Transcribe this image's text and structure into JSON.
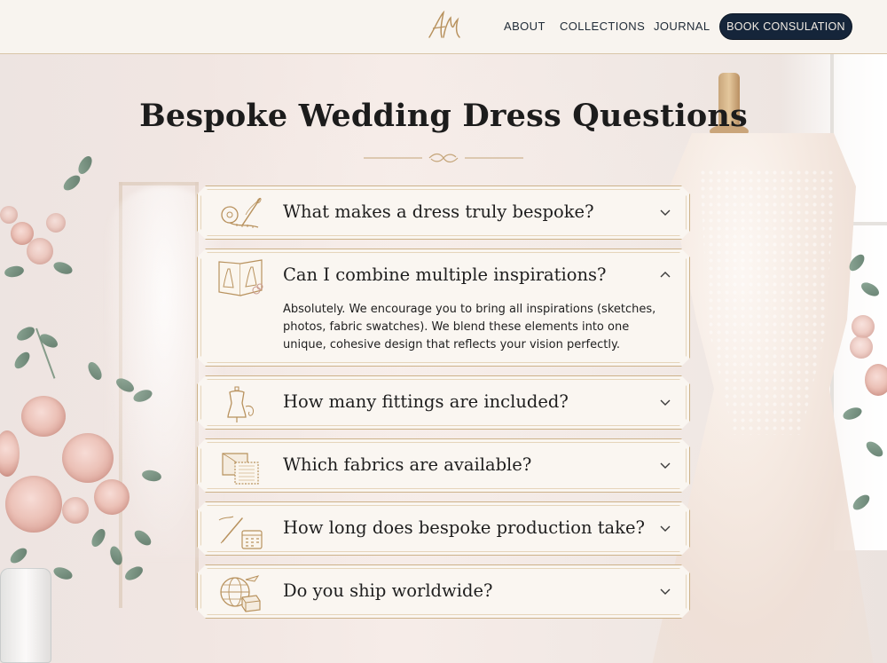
{
  "header": {
    "logo_monogram": "AM",
    "nav": [
      {
        "label": "ABOUT"
      },
      {
        "label": "COLLECTIONS"
      },
      {
        "label": "JOURNAL"
      }
    ],
    "cta_label": "BOOK CONSULATION"
  },
  "page": {
    "title": "Bespoke Wedding Dress Questions"
  },
  "faqs": [
    {
      "question": "What makes a dress truly bespoke?",
      "expanded": false,
      "icon": "measuring-tape-needle-icon"
    },
    {
      "question": "Can I combine multiple inspirations?",
      "expanded": true,
      "icon": "sketchbook-icon",
      "answer": "Absolutely. We encourage you to bring all inspirations (sketches, photos, fabric swatches). We blend these elements into one unique, cohesive design that reflects your vision perfectly."
    },
    {
      "question": "How many fittings are included?",
      "expanded": false,
      "icon": "dress-form-icon"
    },
    {
      "question": "Which fabrics are available?",
      "expanded": false,
      "icon": "fabric-swatch-icon"
    },
    {
      "question": "How long does bespoke production take?",
      "expanded": false,
      "icon": "calendar-pen-icon"
    },
    {
      "question": "Do you ship worldwide?",
      "expanded": false,
      "icon": "globe-parcel-icon"
    }
  ],
  "colors": {
    "gold": "#b8925e",
    "navy": "#15253a",
    "card_bg": "#faf6f1"
  }
}
